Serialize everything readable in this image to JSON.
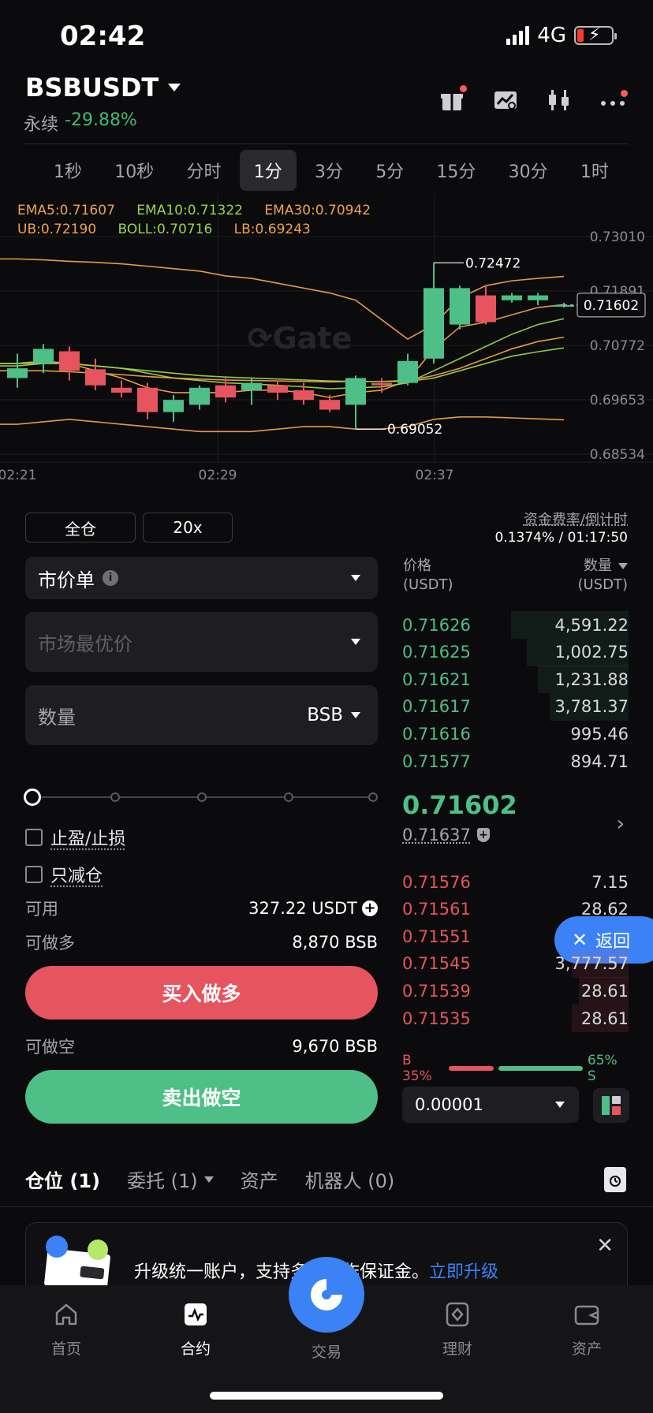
{
  "status": {
    "time": "02:42",
    "network": "4G"
  },
  "header": {
    "pair": "BSBUSDT",
    "type": "永续",
    "change": "-29.88%"
  },
  "header_icons": [
    "gift-icon",
    "chart-swap-icon",
    "candlestick-icon",
    "more-icon"
  ],
  "intervals": [
    "1秒",
    "10秒",
    "分时",
    "1分",
    "3分",
    "5分",
    "15分",
    "30分",
    "1时"
  ],
  "active_interval": "1分",
  "chart_data": {
    "type": "candlestick",
    "indicators": {
      "line1": [
        "EMA5:0.71607",
        "EMA10:0.71322",
        "EMA30:0.70942"
      ],
      "line2": [
        "UB:0.72190",
        "BOLL:0.70716",
        "LB:0.69243"
      ]
    },
    "y_ticks": [
      "0.73010",
      "0.71891",
      "0.70772",
      "0.69653",
      "0.68534"
    ],
    "ylim": [
      0.68534,
      0.7301
    ],
    "x_ticks": [
      "02:21",
      "02:29",
      "02:37"
    ],
    "current_price_tag": "0.71602",
    "high_label": "0.72472",
    "low_label": "0.69052",
    "candles": [
      {
        "o": 0.701,
        "h": 0.706,
        "c": 0.703,
        "l": 0.699
      },
      {
        "o": 0.704,
        "h": 0.708,
        "c": 0.707,
        "l": 0.702
      },
      {
        "o": 0.7065,
        "h": 0.7075,
        "c": 0.7025,
        "l": 0.7005
      },
      {
        "o": 0.7028,
        "h": 0.705,
        "c": 0.6995,
        "l": 0.6985
      },
      {
        "o": 0.699,
        "h": 0.7005,
        "c": 0.698,
        "l": 0.697
      },
      {
        "o": 0.699,
        "h": 0.7,
        "c": 0.694,
        "l": 0.6925
      },
      {
        "o": 0.694,
        "h": 0.6975,
        "c": 0.6965,
        "l": 0.692
      },
      {
        "o": 0.6955,
        "h": 0.6995,
        "c": 0.699,
        "l": 0.6945
      },
      {
        "o": 0.6995,
        "h": 0.701,
        "c": 0.697,
        "l": 0.696
      },
      {
        "o": 0.6985,
        "h": 0.701,
        "c": 0.7,
        "l": 0.6955
      },
      {
        "o": 0.6995,
        "h": 0.7005,
        "c": 0.698,
        "l": 0.6965
      },
      {
        "o": 0.6985,
        "h": 0.7,
        "c": 0.6965,
        "l": 0.6955
      },
      {
        "o": 0.6965,
        "h": 0.6975,
        "c": 0.6945,
        "l": 0.694
      },
      {
        "o": 0.6955,
        "h": 0.7015,
        "c": 0.701,
        "l": 0.6905
      },
      {
        "o": 0.7,
        "h": 0.701,
        "c": 0.6995,
        "l": 0.698
      },
      {
        "o": 0.7,
        "h": 0.706,
        "c": 0.7045,
        "l": 0.6995
      },
      {
        "o": 0.705,
        "h": 0.7247,
        "c": 0.7195,
        "l": 0.704
      },
      {
        "o": 0.712,
        "h": 0.72,
        "c": 0.7195,
        "l": 0.711
      },
      {
        "o": 0.718,
        "h": 0.72,
        "c": 0.7125,
        "l": 0.712
      },
      {
        "o": 0.717,
        "h": 0.7185,
        "c": 0.718,
        "l": 0.7165
      },
      {
        "o": 0.717,
        "h": 0.7185,
        "c": 0.718,
        "l": 0.716
      },
      {
        "o": 0.716,
        "h": 0.7165,
        "c": 0.716,
        "l": 0.7155
      }
    ],
    "lines": {
      "ub": [
        0.7255,
        0.7253,
        0.725,
        0.7248,
        0.7245,
        0.724,
        0.7235,
        0.723,
        0.722,
        0.7215,
        0.7205,
        0.7195,
        0.7185,
        0.717,
        0.713,
        0.709,
        0.712,
        0.7175,
        0.72,
        0.721,
        0.7215,
        0.7219
      ],
      "lb": [
        0.6915,
        0.692,
        0.6925,
        0.692,
        0.6915,
        0.691,
        0.6905,
        0.69,
        0.69,
        0.69,
        0.6905,
        0.691,
        0.691,
        0.6905,
        0.6905,
        0.691,
        0.6925,
        0.693,
        0.693,
        0.6928,
        0.6926,
        0.6924
      ],
      "ema5": [
        0.704,
        0.7045,
        0.704,
        0.7025,
        0.701,
        0.699,
        0.698,
        0.698,
        0.698,
        0.6985,
        0.6985,
        0.698,
        0.697,
        0.698,
        0.6985,
        0.7005,
        0.707,
        0.7115,
        0.7125,
        0.714,
        0.7155,
        0.7161
      ],
      "ema10": [
        0.7035,
        0.704,
        0.704,
        0.7035,
        0.703,
        0.702,
        0.701,
        0.7005,
        0.7,
        0.6998,
        0.6995,
        0.6992,
        0.6988,
        0.699,
        0.6992,
        0.7,
        0.7025,
        0.705,
        0.7075,
        0.71,
        0.712,
        0.7132
      ],
      "ema30": [
        0.7025,
        0.7025,
        0.7023,
        0.702,
        0.7017,
        0.7013,
        0.701,
        0.7008,
        0.7006,
        0.7005,
        0.7004,
        0.7003,
        0.7002,
        0.7003,
        0.7003,
        0.7005,
        0.7015,
        0.703,
        0.705,
        0.707,
        0.7085,
        0.7094
      ],
      "boll": [
        0.704,
        0.704,
        0.704,
        0.7035,
        0.703,
        0.7025,
        0.702,
        0.7015,
        0.7012,
        0.701,
        0.7008,
        0.7006,
        0.7004,
        0.7003,
        0.7003,
        0.7003,
        0.701,
        0.7025,
        0.704,
        0.7055,
        0.7064,
        0.7072
      ]
    }
  },
  "order": {
    "margin_mode": "全仓",
    "leverage": "20x",
    "funding_label": "资金费率/倒计时",
    "funding_value": "0.1374% / 01:17:50",
    "order_type": "市价单",
    "price_placeholder": "市场最优价",
    "quantity_label": "数量",
    "quantity_unit": "BSB",
    "tp_sl": "止盈/止损",
    "reduce_only": "只减仓",
    "available_label": "可用",
    "available_value": "327.22 USDT",
    "long_label": "可做多",
    "long_value": "8,870 BSB",
    "buy_label": "买入做多",
    "short_label": "可做空",
    "short_value": "9,670 BSB",
    "sell_label": "卖出做空"
  },
  "orderbook": {
    "price_header": "价格",
    "price_unit": "(USDT)",
    "qty_header": "数量",
    "qty_unit": "(USDT)",
    "asks": [
      {
        "price": "0.71626",
        "qty": "4,591.22",
        "depth": 0.52
      },
      {
        "price": "0.71625",
        "qty": "1,002.75",
        "depth": 0.45
      },
      {
        "price": "0.71621",
        "qty": "1,231.88",
        "depth": 0.4
      },
      {
        "price": "0.71617",
        "qty": "3,781.37",
        "depth": 0.35
      },
      {
        "price": "0.71616",
        "qty": "995.46",
        "depth": 0.0
      },
      {
        "price": "0.71577",
        "qty": "894.71",
        "depth": 0.0
      }
    ],
    "last_price": "0.71602",
    "mark_price": "0.71637",
    "bids": [
      {
        "price": "0.71576",
        "qty": "7.15",
        "depth": 0.0
      },
      {
        "price": "0.71561",
        "qty": "28.62",
        "depth": 0.0
      },
      {
        "price": "0.71551",
        "qty": "",
        "depth": 0.0
      },
      {
        "price": "0.71545",
        "qty": "3,777.57",
        "depth": 0.25
      },
      {
        "price": "0.71539",
        "qty": "28.61",
        "depth": 0.22
      },
      {
        "price": "0.71535",
        "qty": "28.61",
        "depth": 0.25
      }
    ],
    "buy_ratio": "B 35%",
    "sell_ratio": "65% S",
    "buy_pct": 35,
    "step": "0.00001"
  },
  "float_back": "返回",
  "positions_tabs": [
    "仓位 (1)",
    "委托 (1)",
    "资产",
    "机器人 (0)"
  ],
  "banner": {
    "text": "升级统一账户，支持多币种作保证金。",
    "link": "立即升级"
  },
  "nav": {
    "home": "首页",
    "contract": "合约",
    "trade": "交易",
    "finance": "理财",
    "assets": "资产"
  },
  "colors": {
    "up": "#4ebf86",
    "down": "#e5545f",
    "accent": "#3b82f6",
    "ema5": "#f0a24a",
    "ema10": "#9bd34a",
    "ema30": "#f0a24a",
    "boll": "#9bd34a"
  }
}
